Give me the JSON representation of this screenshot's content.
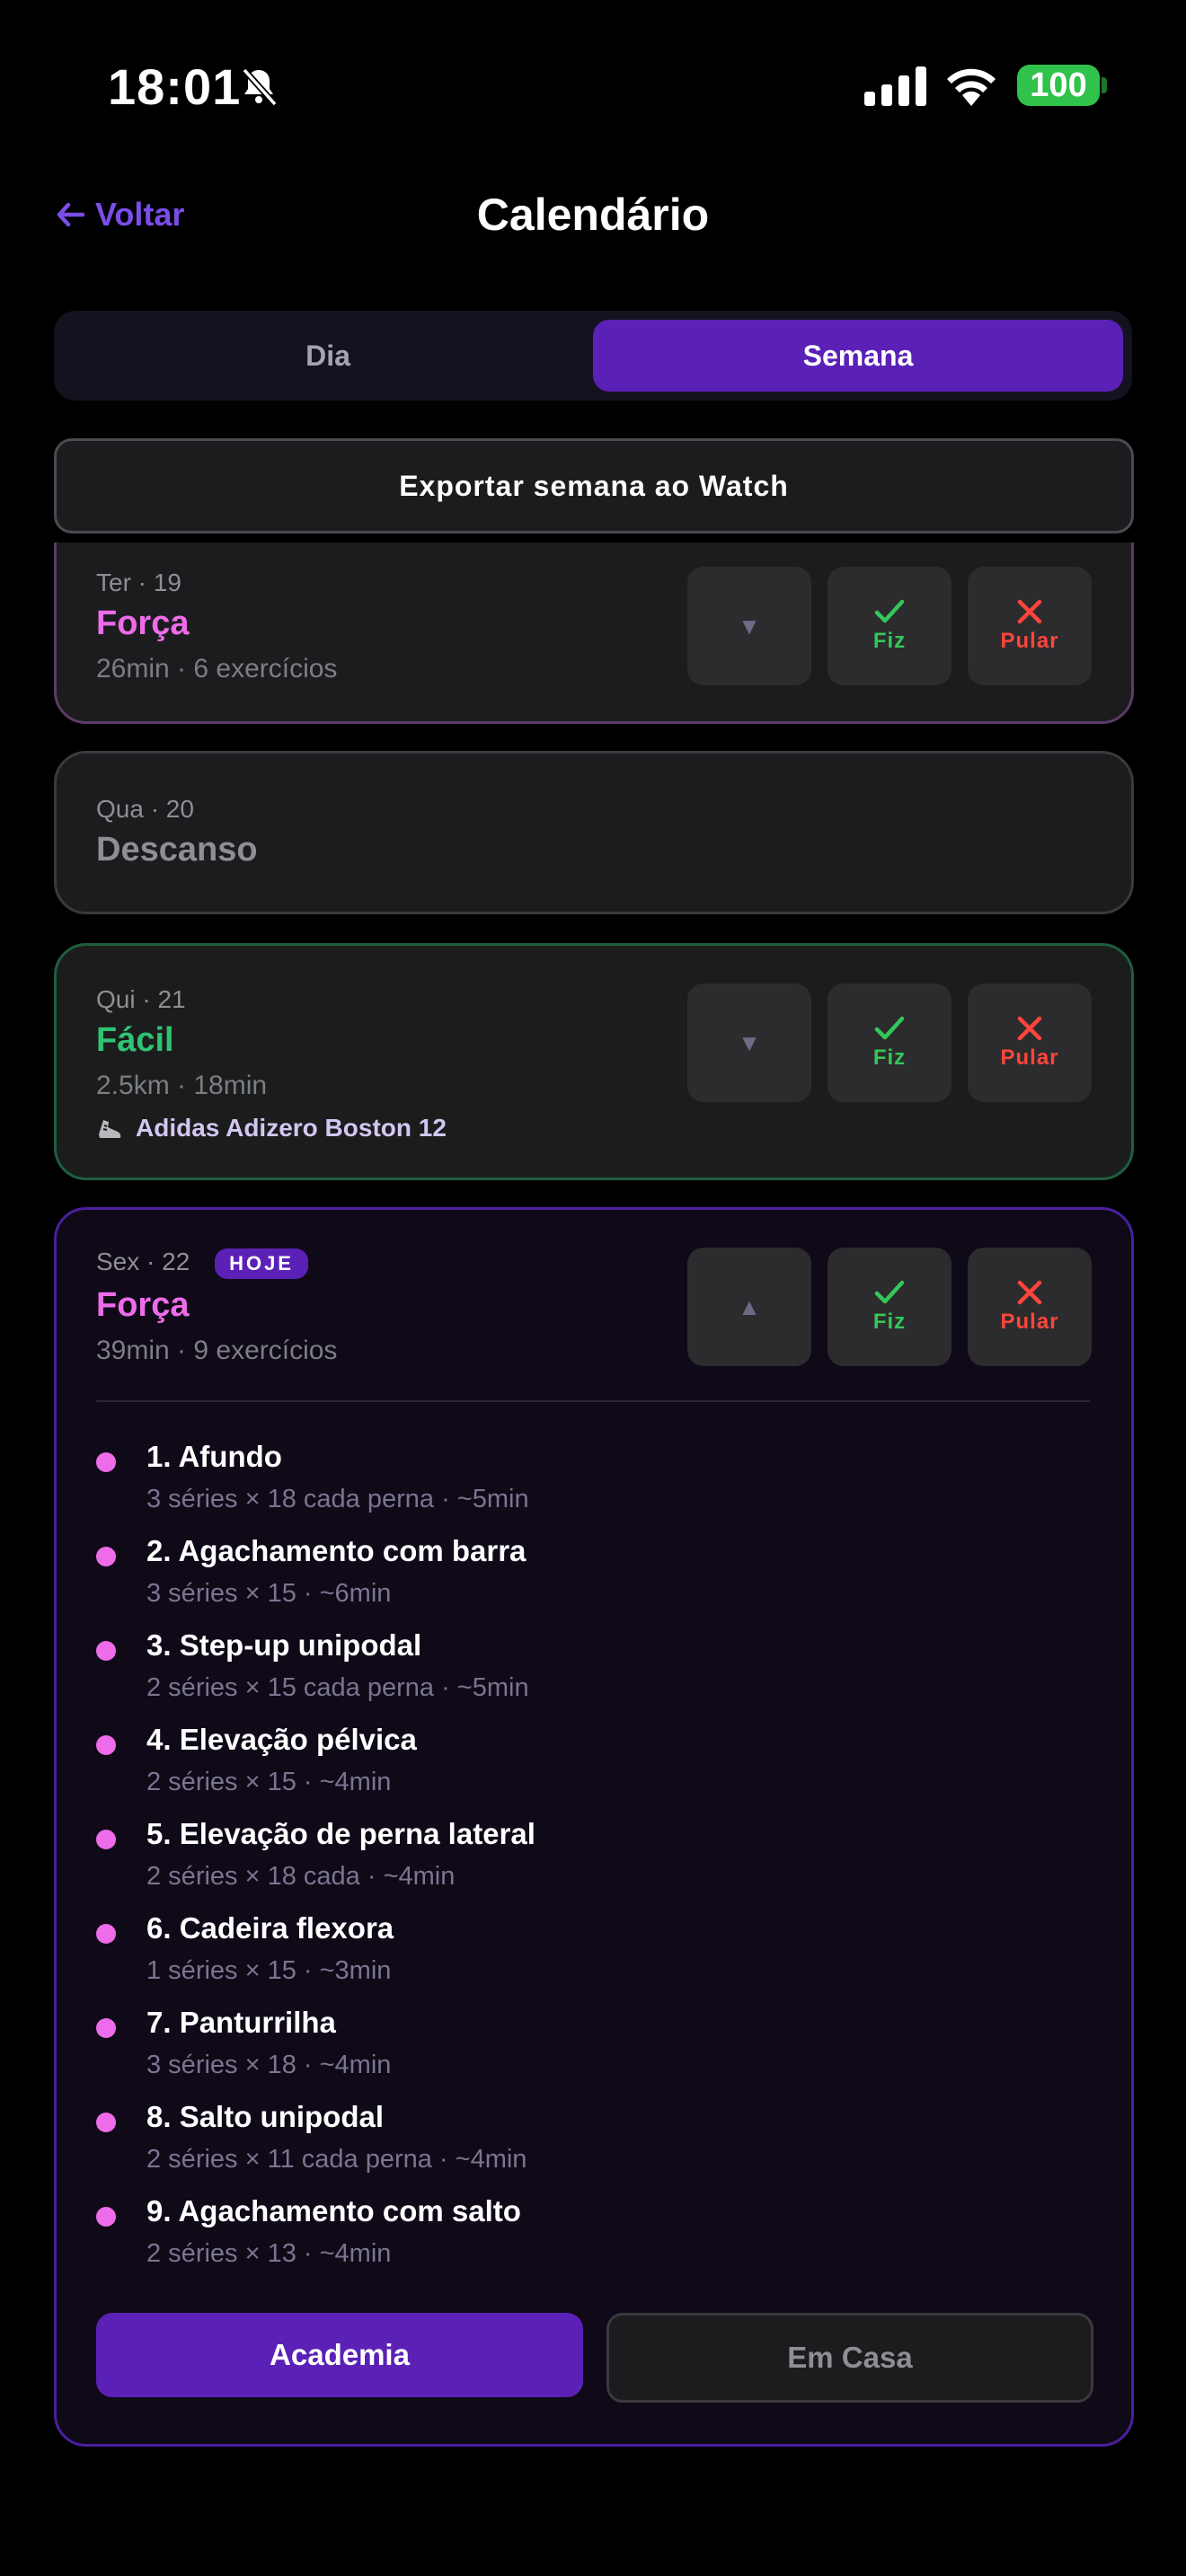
{
  "status_bar": {
    "time": "18:01",
    "battery": "100"
  },
  "header": {
    "back_label": "Voltar",
    "title": "Calendário"
  },
  "segmented": {
    "day_label": "Dia",
    "week_label": "Semana",
    "selected": "Semana"
  },
  "export_label": "Exportar semana ao Watch",
  "action_labels": {
    "done": "Fiz",
    "skip": "Pular"
  },
  "days": [
    {
      "date": "Ter · 19",
      "workout": "Força",
      "summary": "26min · 6 exercícios",
      "color": "#ee6ce9"
    },
    {
      "date": "Qua · 20",
      "workout": "Descanso"
    },
    {
      "date": "Qui · 21",
      "workout": "Fácil",
      "summary": "2.5km · 18min",
      "shoe": "Adidas Adizero Boston 12",
      "color": "#30c275"
    },
    {
      "date": "Sex · 22",
      "badge": "HOJE",
      "workout": "Força",
      "summary": "39min · 9 exercícios",
      "color": "#ee6ce9",
      "exercises": [
        {
          "name": "1. Afundo",
          "detail": "3 séries × 18 cada perna  ·  ~5min"
        },
        {
          "name": "2. Agachamento com barra",
          "detail": "3 séries × 15  ·  ~6min"
        },
        {
          "name": "3. Step-up unipodal",
          "detail": "2 séries × 15 cada perna  ·  ~5min"
        },
        {
          "name": "4. Elevação pélvica",
          "detail": "2 séries × 15  ·  ~4min"
        },
        {
          "name": "5. Elevação de perna lateral",
          "detail": "2 séries × 18 cada  ·  ~4min"
        },
        {
          "name": "6. Cadeira flexora",
          "detail": "1 séries × 15  ·  ~3min"
        },
        {
          "name": "7. Panturrilha",
          "detail": "3 séries × 18  ·  ~4min"
        },
        {
          "name": "8. Salto unipodal",
          "detail": "2 séries × 11 cada perna  ·  ~4min"
        },
        {
          "name": "9. Agachamento com salto",
          "detail": "2 séries × 13  ·  ~4min"
        }
      ],
      "mode_options": [
        "Academia",
        "Em Casa"
      ],
      "mode_selected": "Academia"
    }
  ],
  "colors": {
    "accent": "#5b21b6",
    "strength": "#ee6ce9",
    "easy": "#30c275",
    "done": "#34c759",
    "skip": "#ff453a"
  }
}
